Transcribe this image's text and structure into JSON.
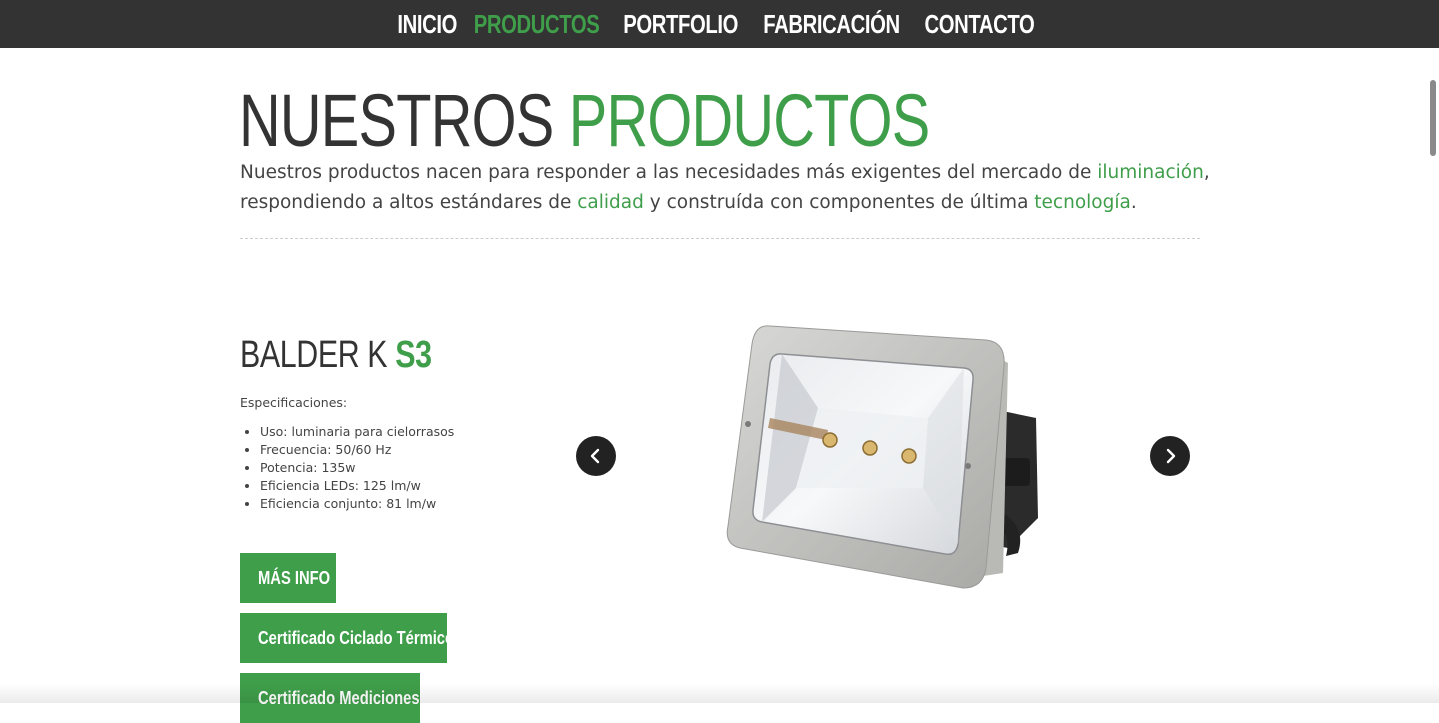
{
  "nav": {
    "items": [
      {
        "label": "INICIO",
        "active": false
      },
      {
        "label": "PRODUCTOS",
        "active": true
      },
      {
        "label": "PORTFOLIO",
        "active": false
      },
      {
        "label": "FABRICACIÓN",
        "active": false
      },
      {
        "label": "CONTACTO",
        "active": false
      }
    ]
  },
  "page": {
    "title_part1": "NUESTROS",
    "title_part2": "PRODUCTOS",
    "intro": {
      "t1": "Nuestros productos nacen para responder a las necesidades más exigentes del mercado de ",
      "k1": "iluminación",
      "t2": ", respondiendo a altos estándares de ",
      "k2": "calidad",
      "t3": " y construída con componentes de última ",
      "k3": "tecnología",
      "t4": "."
    }
  },
  "product": {
    "name_part1": "BALDER K",
    "name_part2": "S3",
    "spec_label": "Especificaciones:",
    "specs": [
      "Uso: luminaria para cielorrasos",
      "Frecuencia: 50/60 Hz",
      "Potencia: 135w",
      "Eficiencia LEDs: 125 lm/w",
      "Eficiencia conjunto: 81 lm/w"
    ],
    "buttons": {
      "info": "MÁS INFO",
      "cert1": "Certificado Ciclado Térmico",
      "cert2": "Certificado Mediciones"
    }
  },
  "carousel": {
    "prev_icon": "chevron-left-icon",
    "next_icon": "chevron-right-icon"
  },
  "colors": {
    "accent": "#3f9e4a",
    "nav_bg": "#333333",
    "text": "#333333"
  }
}
